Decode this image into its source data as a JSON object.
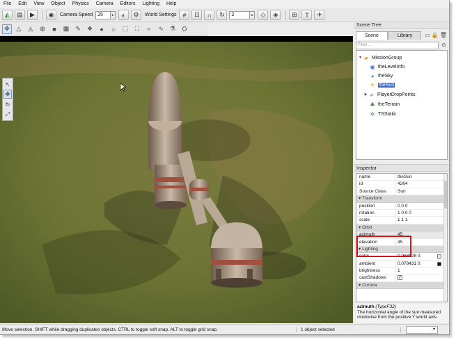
{
  "menu": [
    "File",
    "Edit",
    "View",
    "Object",
    "Physics",
    "Camera",
    "Editors",
    "Lighting",
    "Help"
  ],
  "toolbar": {
    "camera_speed_label": "Camera Speed",
    "camera_speed_value": "25",
    "world_settings_label": "World Settings",
    "snap_value": "2"
  },
  "scene_tree": {
    "title": "Scene Tree",
    "tabs": [
      "Scene",
      "Library"
    ],
    "filter_placeholder": "Filter...",
    "items": [
      {
        "label": "MissionGroup",
        "icon": "folder-open-icon"
      },
      {
        "label": "theLevelInfo",
        "icon": "level-info-icon"
      },
      {
        "label": "theSky",
        "icon": "sky-icon"
      },
      {
        "label": "theSun",
        "icon": "sun-icon"
      },
      {
        "label": "PlayerDropPoints",
        "icon": "folder-icon"
      },
      {
        "label": "theTerrain",
        "icon": "terrain-icon"
      },
      {
        "label": "TSStatic",
        "icon": "static-mesh-icon"
      }
    ]
  },
  "inspector": {
    "title": "Inspector",
    "fields_top": [
      {
        "name": "name",
        "value": "theSun"
      },
      {
        "name": "id",
        "value": "4264"
      },
      {
        "name": "Source Class",
        "value": "Sun"
      }
    ],
    "group_transform": "Transform",
    "fields_transform": [
      {
        "name": "position",
        "value": "0 0 0"
      },
      {
        "name": "rotation",
        "value": "1 0 0 0"
      },
      {
        "name": "scale",
        "value": "1 1 1"
      }
    ],
    "group_orbit": "Orbit",
    "fields_orbit": [
      {
        "name": "azimuth",
        "value": "45"
      },
      {
        "name": "elevation",
        "value": "45"
      }
    ],
    "group_lighting": "Lighting",
    "fields_lighting": [
      {
        "name": "color",
        "value": "0.968628 0."
      },
      {
        "name": "ambient",
        "value": "0.078431 0."
      },
      {
        "name": "brightness",
        "value": "1"
      },
      {
        "name": "castShadows",
        "value": "✓"
      }
    ],
    "group_corona": "Corona",
    "swatch_colors": {
      "color": "#f7e4dc",
      "ambient": "#141414"
    }
  },
  "description": {
    "name": "azimuth",
    "type": "(TypeF32)",
    "text": "The horizontal angle of the sun measured clockwise from the positive Y world axis."
  },
  "status": {
    "message": "Move selection.  SHIFT while dragging duplicates objects.  CTRL to toggle soft snap.  ALT to toggle grid snap.",
    "count": "1 object selected"
  },
  "colors": {
    "highlight_box": "#d4141c",
    "selection": "#3a6fc2"
  }
}
